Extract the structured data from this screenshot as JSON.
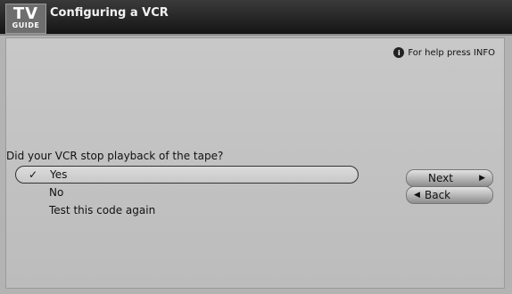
{
  "header": {
    "logo_top": "TV",
    "logo_bottom": "GUIDE",
    "title": "Configuring a VCR"
  },
  "help": {
    "icon": "info-icon",
    "icon_glyph": "i",
    "text": "For help press INFO"
  },
  "question": "Did your VCR stop playback of the tape?",
  "options": [
    {
      "label": "Yes",
      "selected": true
    },
    {
      "label": "No",
      "selected": false
    },
    {
      "label": "Test this code again",
      "selected": false
    }
  ],
  "buttons": {
    "next": "Next",
    "back": "Back"
  },
  "glyphs": {
    "check": "✓",
    "arrow_right": "▶",
    "arrow_left": "◀"
  }
}
